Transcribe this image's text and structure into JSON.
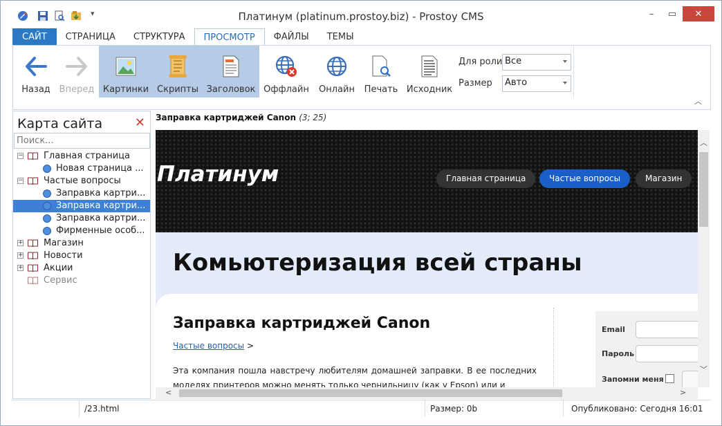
{
  "window": {
    "title": "Платинум (platinum.prostoy.biz) - Prostoy CMS",
    "controls": [
      "–",
      "▭",
      "✕"
    ]
  },
  "ribbon_tabs": [
    {
      "label": "САЙТ"
    },
    {
      "label": "СТРАНИЦА"
    },
    {
      "label": "СТРУКТУРА"
    },
    {
      "label": "ПРОСМОТР"
    },
    {
      "label": "ФАЙЛЫ"
    },
    {
      "label": "ТЕМЫ"
    }
  ],
  "ribbon": {
    "back": "Назад",
    "forward": "Вперед",
    "images": "Картинки",
    "scripts": "Скрипты",
    "header": "Заголовок",
    "offline": "Оффлайн",
    "online": "Онлайн",
    "print": "Печать",
    "source": "Исходник",
    "role_label": "Для роли",
    "role_value": "Все",
    "size_label": "Размер",
    "size_value": "Авто"
  },
  "sidebar": {
    "title": "Карта сайта",
    "search_placeholder": "Поиск...",
    "nodes": [
      {
        "label": "Главная страница"
      },
      {
        "label": "Новая страница ..."
      },
      {
        "label": "Частые вопросы"
      },
      {
        "label": "Заправка картри..."
      },
      {
        "label": "Заправка картри..."
      },
      {
        "label": "Заправка картри..."
      },
      {
        "label": "Фирменные особ..."
      },
      {
        "label": "Магазин"
      },
      {
        "label": "Новости"
      },
      {
        "label": "Акции"
      },
      {
        "label": "Сервис"
      }
    ]
  },
  "content": {
    "crumb_title": "Заправка картриджей Canon",
    "crumb_meta": "(3; 25)",
    "site_logo": "Платинум",
    "nav": [
      "Главная страница",
      "Частые вопросы",
      "Магазин"
    ],
    "hero": "Комьютеризация всей страны",
    "page_title": "Заправка картриджей Canon",
    "breadcrumb_link": "Частые вопросы",
    "breadcrumb_sep": ">",
    "body_text": "Эта компания пошла навстречу любителям домашней заправки. В ее последних моделях принтеров можно менять только чернильницу (как у Epson) или и",
    "login": {
      "email_label": "Email",
      "password_label": "Пароль",
      "remember_label": "Запомни меня"
    }
  },
  "status": {
    "path": "/23.html",
    "size": "Размер: 0b",
    "published": "Опубликовано: Сегодня 16:01"
  },
  "colors": {
    "accent": "#2b78c4",
    "selection": "#3d80d6",
    "nav_active": "#1a5ec8"
  }
}
